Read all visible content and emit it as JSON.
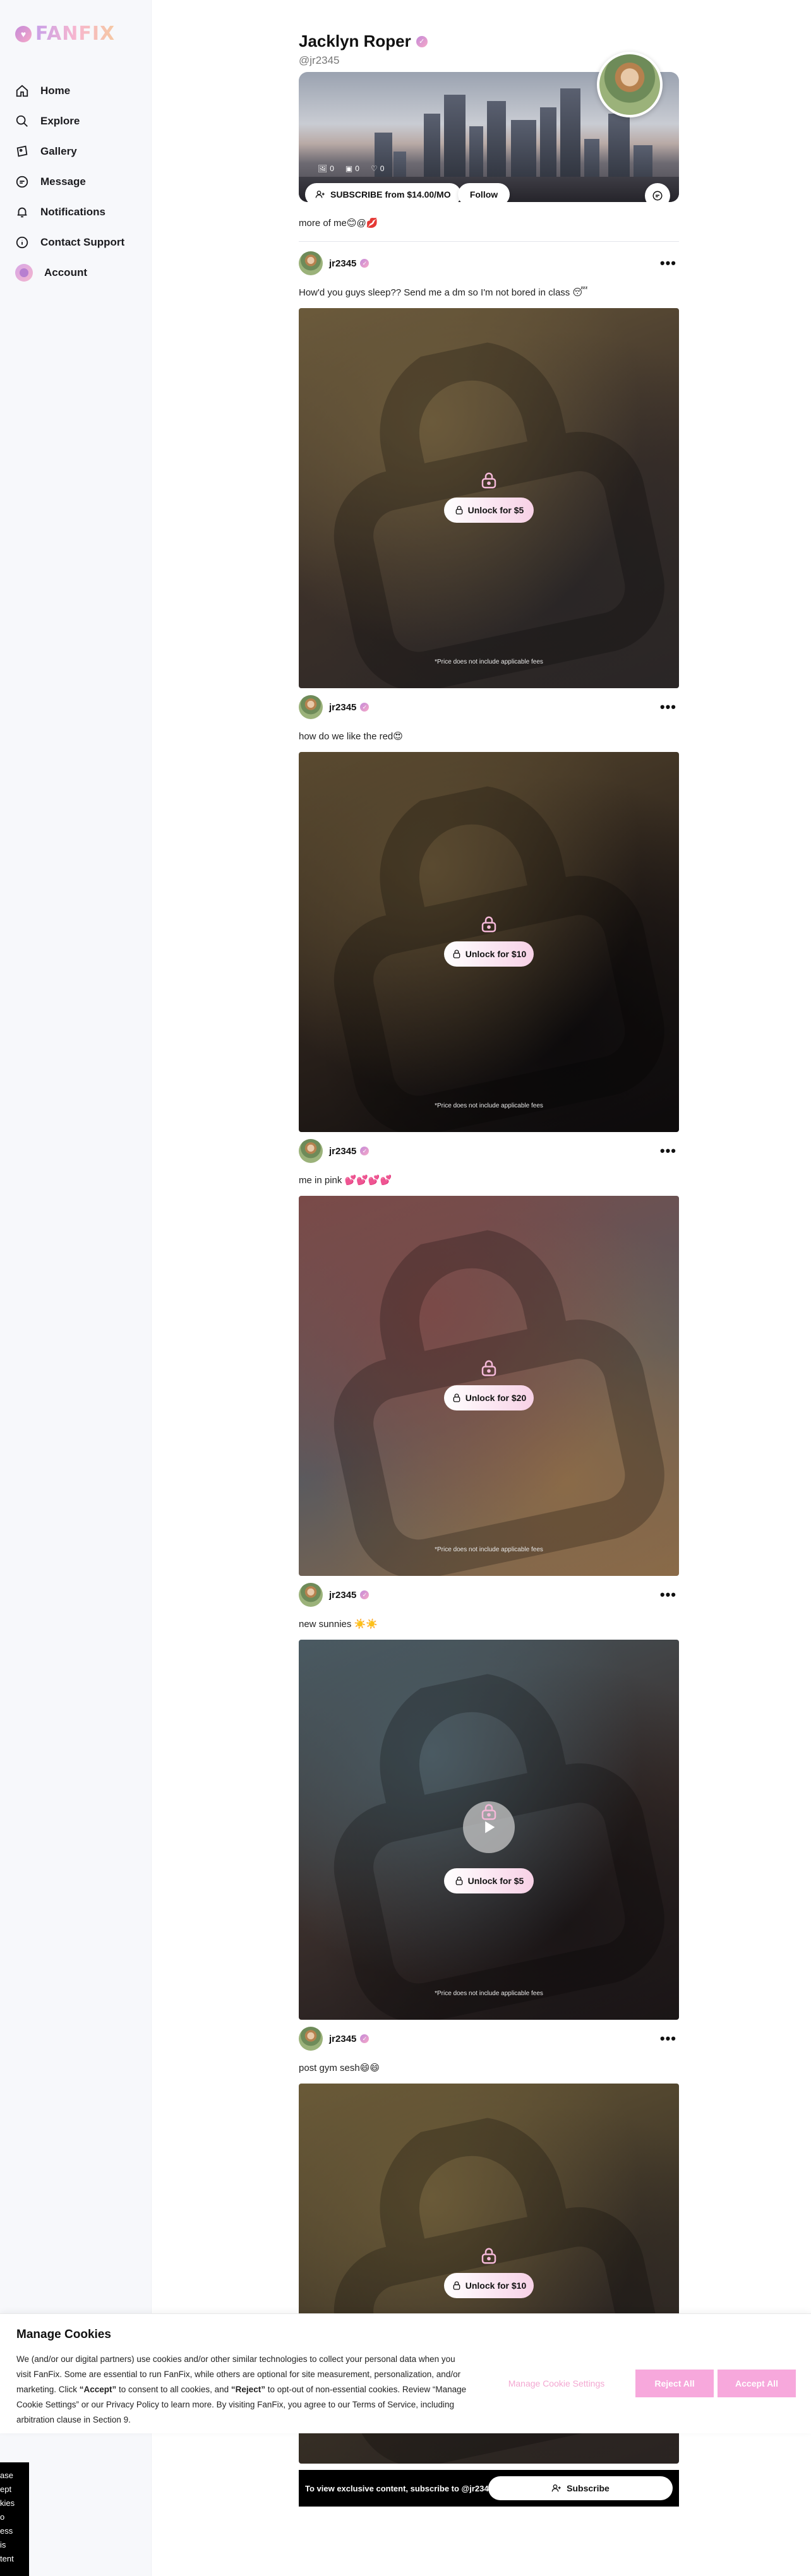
{
  "brand": {
    "name": "FANFIX"
  },
  "nav": {
    "items": [
      {
        "label": "Home",
        "icon": "home-icon"
      },
      {
        "label": "Explore",
        "icon": "search-icon"
      },
      {
        "label": "Gallery",
        "icon": "gallery-icon"
      },
      {
        "label": "Message",
        "icon": "message-icon"
      },
      {
        "label": "Notifications",
        "icon": "bell-icon"
      },
      {
        "label": "Contact Support",
        "icon": "info-icon"
      },
      {
        "label": "Account",
        "icon": "avatar"
      }
    ]
  },
  "profile": {
    "name": "Jacklyn Roper",
    "handle": "@jr2345",
    "bio": "more of me😊@💋",
    "stats": {
      "posts": "0",
      "media": "0",
      "likes": "0"
    },
    "subscribe_label": "SUBSCRIBE from $14.00/MO",
    "follow_label": "Follow"
  },
  "posts": [
    {
      "user": "jr2345",
      "caption": "How'd you guys sleep?? Send me a dm so I'm not bored in class 😴",
      "unlock_label": "Unlock for $5",
      "price_note": "*Price does not include applicable fees",
      "colors": [
        "#6b5a3b",
        "#3b3029",
        "#2a2626"
      ],
      "video": false
    },
    {
      "user": "jr2345",
      "caption": "how do we like the red😍",
      "unlock_label": "Unlock for $10",
      "price_note": "*Price does not include applicable fees",
      "colors": [
        "#5a4a30",
        "#2a211b",
        "#0d0b0c"
      ],
      "video": false
    },
    {
      "user": "jr2345",
      "caption": "me in pink 💕💕💕💕",
      "unlock_label": "Unlock for $20",
      "price_note": "*Price does not include applicable fees",
      "colors": [
        "#7a4a48",
        "#5a5a5e",
        "#8a6a48"
      ],
      "video": false
    },
    {
      "user": "jr2345",
      "caption": "new sunnies ☀️☀️",
      "unlock_label": "Unlock for $5",
      "price_note": "*Price does not include applicable fees",
      "colors": [
        "#4a5a62",
        "#3a2f2c",
        "#1a1516"
      ],
      "video": true
    },
    {
      "user": "jr2345",
      "caption": "post gym sesh😄😄",
      "unlock_label": "Unlock for $10",
      "price_note": "",
      "colors": [
        "#6a5a38",
        "#3a3226",
        "#2a2422"
      ],
      "video": false
    }
  ],
  "cookie": {
    "title": "Manage Cookies",
    "body_1": "We (and/or our digital partners) use cookies and/or other similar technologies to collect your personal data when you visit FanFix. Some are essential to run FanFix, while others are optional for site measurement, personalization, and/or marketing.  Click ",
    "accept_word": "“Accept”",
    "body_2": " to consent to all cookies, and ",
    "reject_word": "“Reject”",
    "body_3": " to opt-out of non-essential cookies.  Review “Manage Cookie Settings” or our Privacy Policy to learn more.  By visiting FanFix, you agree to our Terms of Service, including arbitration clause in Section 9.",
    "manage_label": "Manage Cookie Settings",
    "reject_label": "Reject All",
    "accept_label": "Accept All"
  },
  "sub_bar": {
    "text": "To view exclusive content, subscribe to @jr2345",
    "button_label": "Subscribe"
  },
  "side_fragment": {
    "lines": [
      "ase",
      "ept",
      "kies",
      "o",
      "ess",
      "is",
      "tent"
    ]
  }
}
